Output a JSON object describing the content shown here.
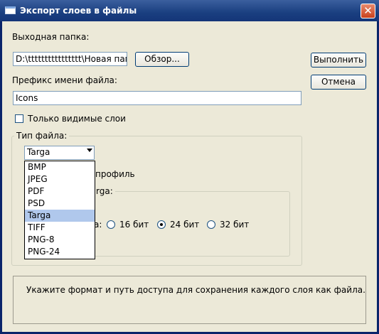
{
  "window": {
    "title": "Экспорт слоев в файлы",
    "close_glyph": "✕"
  },
  "output": {
    "label": "Выходная папка:",
    "value": "D:\\tttttttttttttttt\\Новая пап",
    "browse_label": "Обзор..."
  },
  "actions": {
    "run_label": "Выполнить",
    "cancel_label": "Отмена"
  },
  "prefix": {
    "label": "Префикс имени файла:",
    "value": "Icons"
  },
  "visible_only": {
    "label": "Только видимые слои",
    "checked": false
  },
  "file_type": {
    "group_label": "Тип файла:",
    "selected": "Targa",
    "options": [
      "BMP",
      "JPEG",
      "PDF",
      "PSD",
      "Targa",
      "TIFF",
      "PNG-8",
      "PNG-24"
    ],
    "behind_profile_text": "профиль",
    "behind_group_text": "rga:",
    "behind_depth_text": "а:"
  },
  "depth": {
    "options": [
      "16 бит",
      "24 бит",
      "32 бит"
    ],
    "selected": "24 бит"
  },
  "info": {
    "text": "Укажите формат и путь доступа для сохранения каждого слоя как файла."
  },
  "colors": {
    "titlebar": "#1a3f80",
    "dialog_bg": "#ece9d8",
    "close": "#c9401c",
    "highlight": "#b0c8ec"
  }
}
